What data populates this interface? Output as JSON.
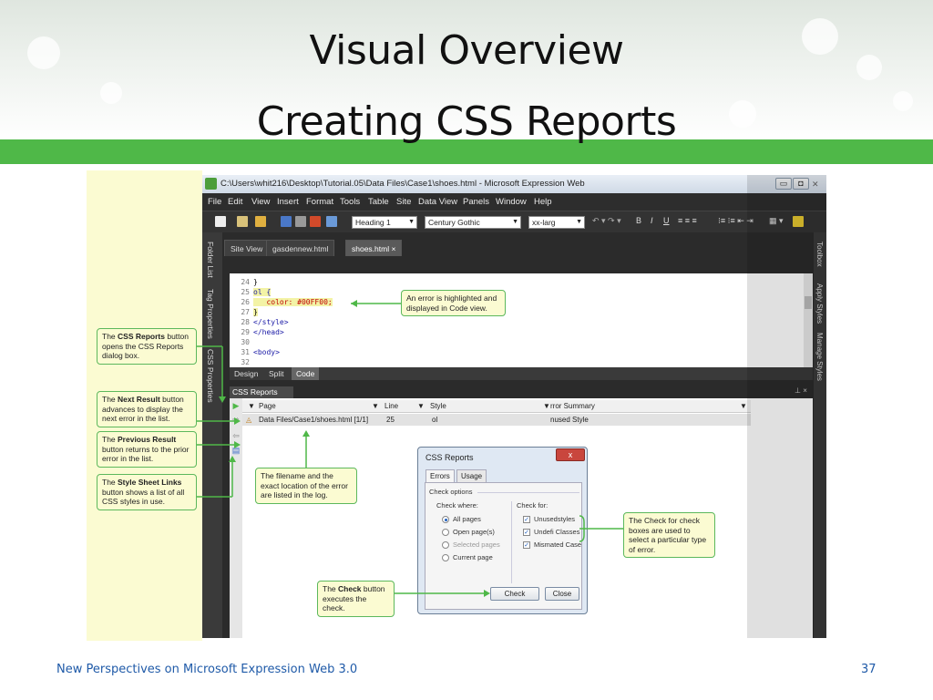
{
  "slide": {
    "title_line1": "Visual Overview",
    "title_line2": "Creating CSS Reports",
    "footer": "New Perspectives on Microsoft Expression Web 3.0",
    "page_number": "37"
  },
  "colors": {
    "accent_green": "#4fb848",
    "callout_bg": "#fbfbd2",
    "footer_blue": "#1f5aa8"
  },
  "app": {
    "title": "C:\\Users\\whit216\\Desktop\\Tutorial.05\\Data Files\\Case1\\shoes.html - Microsoft Expression Web",
    "menu": [
      "File",
      "Edit",
      "View",
      "Insert",
      "Format",
      "Tools",
      "Table",
      "Site",
      "Data View",
      "Panels",
      "Window",
      "Help"
    ],
    "toolbar": {
      "style_combo": "Heading 1",
      "font_combo": "Century Gothic",
      "size_combo": "xx-larg"
    },
    "left_panels": [
      "Folder List",
      "Tag Properties",
      "CSS Properties"
    ],
    "right_panels": [
      "Toolbox",
      "Apply Styles",
      "Manage Styles"
    ],
    "doc_tabs": [
      "Site View",
      "gasdennew.html",
      "shoes.html"
    ],
    "code_lines": [
      {
        "num": "24",
        "text": "}"
      },
      {
        "num": "25",
        "text": "ol {"
      },
      {
        "num": "26",
        "text": "   color: #00FF00;"
      },
      {
        "num": "27",
        "text": "}"
      },
      {
        "num": "28",
        "text": "</style>"
      },
      {
        "num": "29",
        "text": "</head>"
      },
      {
        "num": "30",
        "text": ""
      },
      {
        "num": "31",
        "text": "<body>"
      },
      {
        "num": "32",
        "text": ""
      }
    ],
    "view_tabs": [
      "Design",
      "Split",
      "Code"
    ],
    "reports_panel": {
      "title": "CSS Reports",
      "columns": [
        "Page",
        "Line",
        "Style",
        "rror Summary"
      ],
      "row": {
        "page": "Data Files/Case1/shoes.html [1/1]",
        "line": "25",
        "style": "ol",
        "summary": "nused Style"
      }
    },
    "dialog": {
      "title": "CSS Reports",
      "close_label": "x",
      "tabs": [
        "Errors",
        "Usage"
      ],
      "check_options": "Check options",
      "check_where": "Check where:",
      "check_for": "Check for:",
      "where_options": [
        {
          "label": "All pages",
          "selected": true,
          "disabled": false
        },
        {
          "label": "Open page(s)",
          "selected": false,
          "disabled": false
        },
        {
          "label": "Selected pages",
          "selected": false,
          "disabled": true
        },
        {
          "label": "Current page",
          "selected": false,
          "disabled": false
        }
      ],
      "for_options": [
        "Unusedstyles",
        "Undefi Classes",
        "Mismated Case"
      ],
      "check_button": "Check",
      "close_button": "Close"
    }
  },
  "callouts": {
    "code_error": "An error is highlighted and displayed in Code view.",
    "css_reports_button": {
      "pre": "The ",
      "bold": "CSS Reports",
      "post": " button opens the CSS Reports dialog box."
    },
    "next_result": {
      "pre": "The ",
      "bold": "Next Result",
      "post": " button advances to display the next error in the list."
    },
    "previous_result": {
      "pre": "The ",
      "bold": "Previous Result",
      "post": " button returns to the prior error in the list."
    },
    "style_sheet_links": {
      "pre": "The ",
      "bold": "Style Sheet Links",
      "post": " button shows a list of all CSS styles in use."
    },
    "filename": "The filename and the exact location of the error are listed in the log.",
    "check_for_boxes": "The Check for check boxes are used to select a particular type of error.",
    "check_button": {
      "pre": "The ",
      "bold": "Check",
      "post": " button executes the check."
    }
  }
}
